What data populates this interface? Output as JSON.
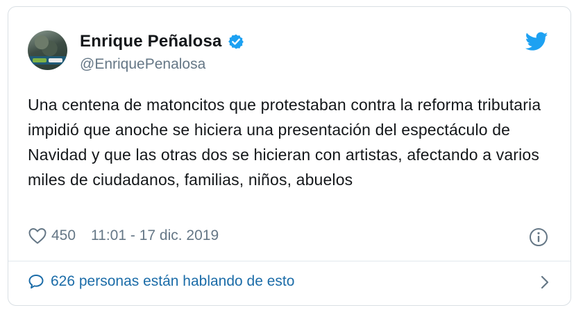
{
  "author": {
    "name": "Enrique Peñalosa",
    "handle": "@EnriquePenalosa",
    "verified": true
  },
  "tweet": {
    "text": "Una centena de matoncitos que protestaban contra la reforma tributaria impidió que anoche se hiciera una presentación del espectáculo de Navidad y que las otras dos se hicieran con artistas, afectando a varios miles de ciudadanos, familias, niños, abuelos"
  },
  "meta": {
    "likes": "450",
    "timestamp": "11:01 - 17 dic. 2019"
  },
  "footer": {
    "conversation_label": "626 personas están hablando de esto"
  },
  "icons": {
    "heart": "heart-icon",
    "info": "info-icon",
    "bubble": "speech-bubble-icon",
    "chevron": "chevron-right-icon",
    "bird": "twitter-bird-icon",
    "verified": "verified-badge-icon"
  },
  "colors": {
    "twitter_blue": "#1da1f2",
    "text": "#14171a",
    "muted": "#657786",
    "link": "#1b6ca8"
  }
}
